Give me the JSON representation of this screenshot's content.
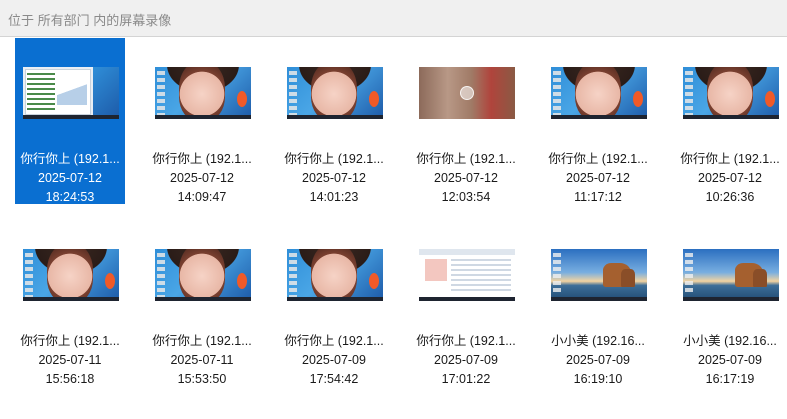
{
  "search": {
    "placeholder": "位于 所有部门 内的屏幕录像"
  },
  "items": [
    {
      "name": "你行你上 (192.1...",
      "date": "2025-07-12",
      "time": "18:24:53",
      "thumb": "app",
      "selected": true
    },
    {
      "name": "你行你上 (192.1...",
      "date": "2025-07-12",
      "time": "14:09:47",
      "thumb": "anime"
    },
    {
      "name": "你行你上 (192.1...",
      "date": "2025-07-12",
      "time": "14:01:23",
      "thumb": "anime"
    },
    {
      "name": "你行你上 (192.1...",
      "date": "2025-07-12",
      "time": "12:03:54",
      "thumb": "blur"
    },
    {
      "name": "你行你上 (192.1...",
      "date": "2025-07-12",
      "time": "11:17:12",
      "thumb": "anime"
    },
    {
      "name": "你行你上 (192.1...",
      "date": "2025-07-12",
      "time": "10:26:36",
      "thumb": "anime"
    },
    {
      "name": "你行你上 (192.1...",
      "date": "2025-07-11",
      "time": "15:56:18",
      "thumb": "anime"
    },
    {
      "name": "你行你上 (192.1...",
      "date": "2025-07-11",
      "time": "15:53:50",
      "thumb": "anime"
    },
    {
      "name": "你行你上 (192.1...",
      "date": "2025-07-09",
      "time": "17:54:42",
      "thumb": "anime"
    },
    {
      "name": "你行你上 (192.1...",
      "date": "2025-07-09",
      "time": "17:01:22",
      "thumb": "doc"
    },
    {
      "name": "小小美 (192.16...",
      "date": "2025-07-09",
      "time": "16:19:10",
      "thumb": "lake"
    },
    {
      "name": "小小美 (192.16...",
      "date": "2025-07-09",
      "time": "16:17:19",
      "thumb": "lake"
    }
  ],
  "colors": {
    "selection": "#0a6fd1",
    "toolbar_bg": "#f0f0f0"
  }
}
